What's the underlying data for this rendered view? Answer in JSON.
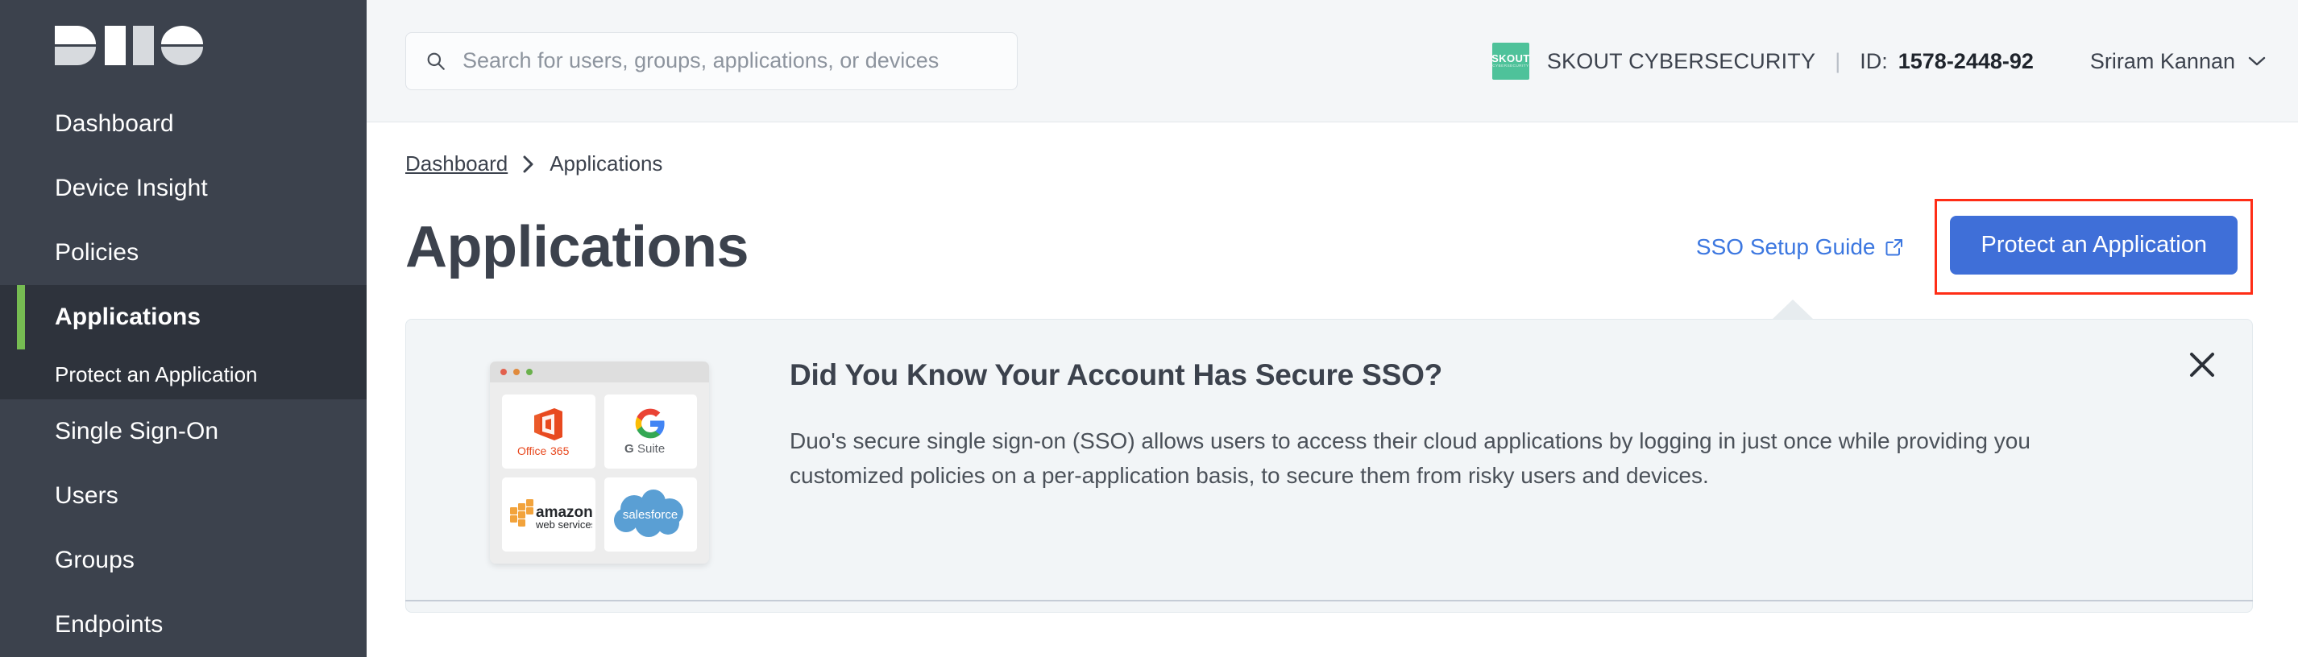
{
  "brand": {
    "logo_alt": "duo-logo",
    "accent_green": "#76bc52",
    "sidebar_bg": "#3c424d",
    "sidebar_active_bg": "#2e333c"
  },
  "sidebar": {
    "items": [
      {
        "label": "Dashboard",
        "active": false
      },
      {
        "label": "Device Insight",
        "active": false
      },
      {
        "label": "Policies",
        "active": false
      },
      {
        "label": "Applications",
        "active": true
      },
      {
        "label": "Single Sign-On",
        "active": false
      },
      {
        "label": "Users",
        "active": false
      },
      {
        "label": "Groups",
        "active": false
      },
      {
        "label": "Endpoints",
        "active": false
      }
    ],
    "sub_item": {
      "label": "Protect an Application"
    }
  },
  "topbar": {
    "search": {
      "placeholder": "Search for users, groups, applications, or devices",
      "value": "",
      "icon": "search-icon"
    },
    "org": {
      "badge_title": "SKOUT",
      "badge_subtitle": "CYBERSECURITY",
      "name": "SKOUT CYBERSECURITY",
      "separator": "|",
      "id_label": "ID:",
      "id_value": "1578-2448-92",
      "badge_color": "#4ec29a"
    },
    "user": {
      "name": "Sriram Kannan",
      "chevron_icon": "chevron-down-icon"
    }
  },
  "breadcrumb": {
    "parent": "Dashboard",
    "separator_icon": "chevron-right-icon",
    "current": "Applications"
  },
  "page": {
    "title": "Applications",
    "sso_guide_link": "SSO Setup Guide",
    "sso_guide_icon": "external-link-icon",
    "protect_button": "Protect an Application",
    "protect_button_color": "#3f6fd8",
    "highlight_color": "#ff2d16"
  },
  "promo": {
    "title": "Did You Know Your Account Has Secure SSO?",
    "body": "Duo's secure single sign-on (SSO) allows users to access their cloud applications by logging in just once while providing you customized policies on a per-application basis, to secure them from risky users and devices.",
    "close_icon": "close-icon",
    "illustration": {
      "window_dots": [
        "red",
        "yellow",
        "green"
      ],
      "tiles": [
        {
          "name": "Office 365",
          "icon": "office365-icon"
        },
        {
          "name": "G Suite",
          "icon": "gsuite-icon"
        },
        {
          "name": "amazon web services",
          "icon": "aws-icon"
        },
        {
          "name": "salesforce",
          "icon": "salesforce-icon"
        }
      ]
    }
  }
}
